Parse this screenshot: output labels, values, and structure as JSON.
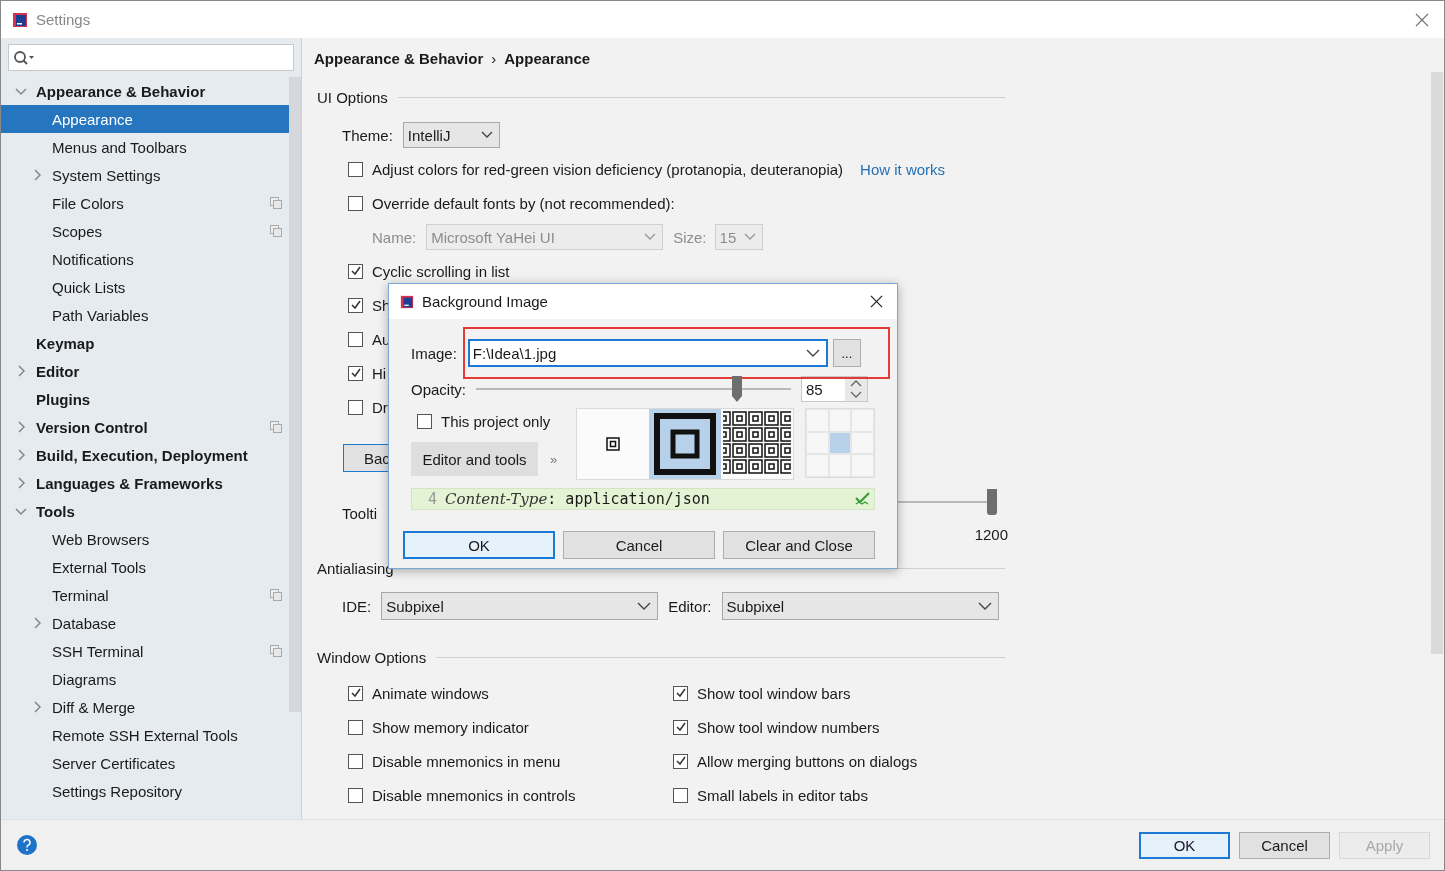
{
  "window": {
    "title": "Settings"
  },
  "sidebar": {
    "tree": [
      {
        "label": "Appearance & Behavior",
        "expanded": true,
        "selected": false,
        "children": [
          {
            "label": "Appearance",
            "selected": true
          },
          {
            "label": "Menus and Toolbars",
            "selected": false
          },
          {
            "label": "System Settings",
            "expanded": false,
            "selected": false
          },
          {
            "label": "File Colors",
            "selected": false,
            "project_icon": true
          },
          {
            "label": "Scopes",
            "selected": false,
            "project_icon": true
          },
          {
            "label": "Notifications",
            "selected": false
          },
          {
            "label": "Quick Lists",
            "selected": false
          },
          {
            "label": "Path Variables",
            "selected": false
          }
        ]
      },
      {
        "label": "Keymap",
        "selected": false
      },
      {
        "label": "Editor",
        "expanded": false,
        "selected": false
      },
      {
        "label": "Plugins",
        "selected": false
      },
      {
        "label": "Version Control",
        "expanded": false,
        "selected": false,
        "project_icon": true
      },
      {
        "label": "Build, Execution, Deployment",
        "expanded": false,
        "selected": false
      },
      {
        "label": "Languages & Frameworks",
        "expanded": false,
        "selected": false
      },
      {
        "label": "Tools",
        "expanded": true,
        "selected": false,
        "children": [
          {
            "label": "Web Browsers",
            "selected": false
          },
          {
            "label": "External Tools",
            "selected": false
          },
          {
            "label": "Terminal",
            "selected": false,
            "project_icon": true
          },
          {
            "label": "Database",
            "expanded": false,
            "selected": false
          },
          {
            "label": "SSH Terminal",
            "selected": false,
            "project_icon": true
          },
          {
            "label": "Diagrams",
            "selected": false
          },
          {
            "label": "Diff & Merge",
            "expanded": false,
            "selected": false
          },
          {
            "label": "Remote SSH External Tools",
            "selected": false
          },
          {
            "label": "Server Certificates",
            "selected": false
          },
          {
            "label": "Settings Repository",
            "selected": false
          }
        ]
      }
    ]
  },
  "breadcrumb": [
    "Appearance & Behavior",
    "›",
    "Appearance"
  ],
  "ui_options": {
    "heading": "UI Options",
    "theme": {
      "label": "Theme:",
      "value": "IntelliJ"
    },
    "color_deficiency": {
      "label": "Adjust colors for red-green vision deficiency (protanopia, deuteranopia)",
      "checked": false,
      "link": "How it works"
    },
    "override_fonts": {
      "label": "Override default fonts by (not recommended):",
      "checked": false
    },
    "font": {
      "name_label": "Name:",
      "name": "Microsoft YaHei UI",
      "size_label": "Size:",
      "size": "15",
      "disabled": true
    },
    "options": [
      {
        "label": "Cyclic scrolling in list",
        "checked": true
      },
      {
        "label": "Sh",
        "checked": true
      },
      {
        "label": "Au",
        "checked": false
      },
      {
        "label": "Hi",
        "checked": true
      },
      {
        "label": "Dr",
        "checked": false
      }
    ],
    "background_button": "Bac",
    "tooltip": {
      "label": "Toolti",
      "level": 1,
      "max_label": "1200"
    }
  },
  "antialiasing": {
    "heading": "Antialiasing",
    "ide_label": "IDE:",
    "ide": "Subpixel",
    "editor_label": "Editor:",
    "editor": "Subpixel"
  },
  "window_options": {
    "heading": "Window Options",
    "columns": [
      [
        {
          "label": "Animate windows",
          "checked": true
        },
        {
          "label": "Show memory indicator",
          "checked": false
        },
        {
          "label": "Disable mnemonics in menu",
          "checked": false
        },
        {
          "label": "Disable mnemonics in controls",
          "checked": false
        }
      ],
      [
        {
          "label": "Show tool window bars",
          "checked": true
        },
        {
          "label": "Show tool window numbers",
          "checked": true
        },
        {
          "label": "Allow merging buttons on dialogs",
          "checked": true
        },
        {
          "label": "Small labels in editor tabs",
          "checked": false
        }
      ]
    ]
  },
  "footer": {
    "buttons": [
      {
        "label": "OK",
        "kind": "default"
      },
      {
        "label": "Cancel",
        "kind": "normal"
      },
      {
        "label": "Apply",
        "kind": "disabled"
      }
    ]
  },
  "dialog": {
    "title": "Background Image",
    "image_label": "Image:",
    "image": "F:\\Idea\\1.jpg",
    "browse": "...",
    "opacity_label": "Opacity:",
    "opacity": {
      "level": 0.83
    },
    "opacity_value": "85",
    "this_project_only": {
      "label": "This project only",
      "checked": false
    },
    "target_button": "Editor and tools",
    "more": "»",
    "fill_modes": [
      {
        "kind": "center",
        "selected": false
      },
      {
        "kind": "stretch",
        "selected": true
      },
      {
        "kind": "tile",
        "selected": false
      }
    ],
    "anchors": [
      {
        "selected": false
      },
      {
        "selected": false
      },
      {
        "selected": false
      },
      {
        "selected": false
      },
      {
        "selected": true
      },
      {
        "selected": false
      },
      {
        "selected": false
      },
      {
        "selected": false
      },
      {
        "selected": false
      }
    ],
    "preview": {
      "line_number": "4",
      "key": "Content-Type",
      "rest": ": application/json"
    },
    "buttons": [
      {
        "label": "OK",
        "kind": "default"
      },
      {
        "label": "Cancel",
        "kind": "normal"
      },
      {
        "label": "Clear and Close",
        "kind": "normal"
      }
    ]
  }
}
